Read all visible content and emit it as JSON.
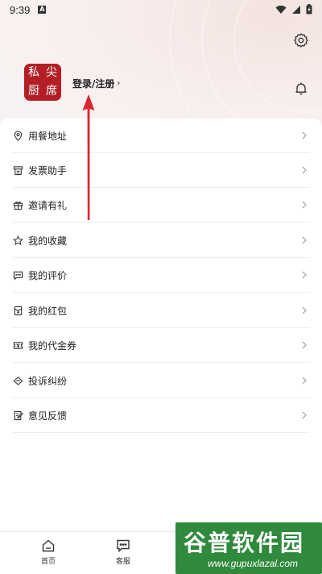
{
  "status_bar": {
    "time": "9:39",
    "notif_badge": "A"
  },
  "profile": {
    "avatar_chars": [
      "私",
      "尖",
      "厨",
      "席"
    ],
    "login_label": "登录/注册",
    "login_chevron": "›"
  },
  "menu": {
    "items": [
      {
        "label": "用餐地址",
        "icon": "location-icon"
      },
      {
        "label": "发票助手",
        "icon": "invoice-icon"
      },
      {
        "label": "邀请有礼",
        "icon": "gift-icon"
      },
      {
        "label": "我的收藏",
        "icon": "star-icon"
      },
      {
        "label": "我的评价",
        "icon": "comment-icon"
      },
      {
        "label": "我的红包",
        "icon": "red-packet-icon"
      },
      {
        "label": "我的代金券",
        "icon": "coupon-icon"
      },
      {
        "label": "投诉纠纷",
        "icon": "complaint-icon"
      },
      {
        "label": "意见反馈",
        "icon": "feedback-icon"
      }
    ]
  },
  "tabs": [
    {
      "label": "首页",
      "icon": "home-icon"
    },
    {
      "label": "客服",
      "icon": "chat-icon"
    }
  ],
  "watermark": {
    "title": "谷普软件园",
    "url": "www.gupuxlazal.com"
  },
  "colors": {
    "brand_red": "#b41f26",
    "arrow_red": "#d9262c",
    "watermark_green": "#2f8a3c"
  }
}
